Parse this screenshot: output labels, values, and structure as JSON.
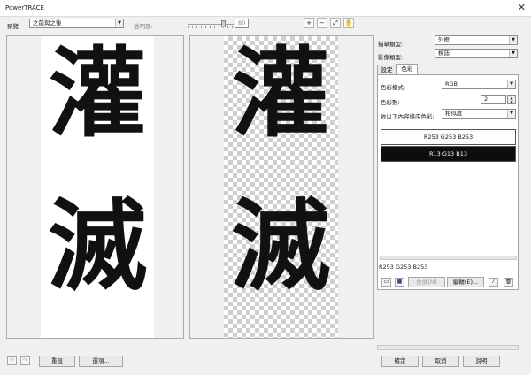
{
  "window": {
    "title": "PowerTRACE",
    "close_glyph": "✕"
  },
  "toolbar": {
    "preview_label": "預覽",
    "preview_mode": "之前與之後",
    "opacity_label": "透明度:",
    "opacity_value": "80",
    "opacity_level_percent": 80,
    "tools": [
      {
        "icon": "zoom-in-icon",
        "glyph": "+"
      },
      {
        "icon": "zoom-out-icon",
        "glyph": "−"
      },
      {
        "icon": "zoom-fit-icon",
        "glyph": "⤢"
      },
      {
        "icon": "hand-pan-icon",
        "glyph": "✋"
      }
    ]
  },
  "preview": {
    "glyphs": [
      "灌",
      "滅"
    ]
  },
  "settings": {
    "trace_type_label": "描摹類型:",
    "trace_type_value": "外框",
    "image_type_label": "影像類型:",
    "image_type_value": "標誌",
    "tabs": [
      "設定",
      "色彩"
    ],
    "active_tab": 1,
    "color_mode_label": "色彩模式:",
    "color_mode_value": "RGB",
    "color_count_label": "色彩數:",
    "color_count_value": "2",
    "sort_label": "依以下內容排序色彩:",
    "sort_value": "相似度",
    "colors": [
      {
        "label": "R253 G253 B253",
        "bg": "#fdfdfd",
        "fg": "#111111"
      },
      {
        "label": "R13 G13 B13",
        "bg": "#0d0d0d",
        "fg": "#ffffff"
      }
    ],
    "selected_color_readout": "R253 G253 B253",
    "merge_button": "合併(M)",
    "edit_button": "編輯(E)..."
  },
  "bottom": {
    "reset_button": "重設",
    "options_button": "選項...",
    "ok_button": "確定",
    "cancel_button": "取消",
    "help_button": "說明"
  }
}
